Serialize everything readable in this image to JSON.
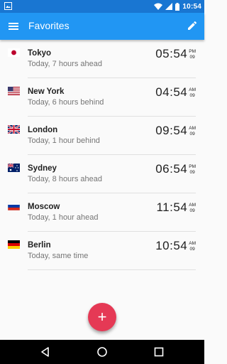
{
  "status_bar": {
    "time": "10:54",
    "icons": [
      "image-icon",
      "wifi-icon",
      "signal-icon",
      "battery-icon"
    ]
  },
  "app_bar": {
    "title": "Favorites",
    "menu_icon": "menu-icon",
    "edit_icon": "edit-icon"
  },
  "favorites": [
    {
      "city": "Tokyo",
      "diff": "Today, 7 hours ahead",
      "time": "05:54",
      "ampm": "PM",
      "seconds": "09",
      "flag": "japan"
    },
    {
      "city": "New York",
      "diff": "Today, 6 hours behind",
      "time": "04:54",
      "ampm": "AM",
      "seconds": "09",
      "flag": "usa"
    },
    {
      "city": "London",
      "diff": "Today, 1 hour behind",
      "time": "09:54",
      "ampm": "AM",
      "seconds": "09",
      "flag": "uk"
    },
    {
      "city": "Sydney",
      "diff": "Today, 8 hours ahead",
      "time": "06:54",
      "ampm": "PM",
      "seconds": "09",
      "flag": "australia"
    },
    {
      "city": "Moscow",
      "diff": "Today, 1 hour ahead",
      "time": "11:54",
      "ampm": "AM",
      "seconds": "09",
      "flag": "russia"
    },
    {
      "city": "Berlin",
      "diff": "Today, same time",
      "time": "10:54",
      "ampm": "AM",
      "seconds": "09",
      "flag": "germany"
    }
  ],
  "fab": {
    "label": "+"
  },
  "colors": {
    "status_bar": "#1976d2",
    "app_bar": "#2196f3",
    "fab": "#e53955",
    "background": "#fafafa"
  },
  "nav_bar": {
    "icons": [
      "back-icon",
      "home-icon",
      "recents-icon"
    ]
  }
}
